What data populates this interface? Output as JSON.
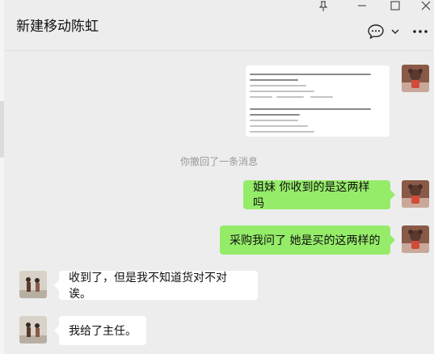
{
  "window": {
    "title": "新建移动陈虹"
  },
  "header_icons": {
    "pin": "pin-icon",
    "minimize": "minimize-icon",
    "maximize": "maximize-icon",
    "close": "close-icon",
    "chat": "chat-bubble-icon",
    "dropdown": "chevron-down-icon",
    "more": "more-icon"
  },
  "messages": [
    {
      "type": "image",
      "side": "right"
    },
    {
      "type": "system",
      "text": "你撤回了一条消息"
    },
    {
      "type": "text",
      "side": "right",
      "text": "姐妹 你收到的是这两样吗"
    },
    {
      "type": "text",
      "side": "right",
      "text": "采购我问了 她是买的这两样的"
    },
    {
      "type": "text",
      "side": "left",
      "text": "收到了，但是我不知道货对不对诶。"
    },
    {
      "type": "text",
      "side": "left",
      "text": "我给了主任。"
    }
  ],
  "colors": {
    "self_bubble": "#95ec69",
    "other_bubble": "#ffffff",
    "background": "#ededed"
  }
}
